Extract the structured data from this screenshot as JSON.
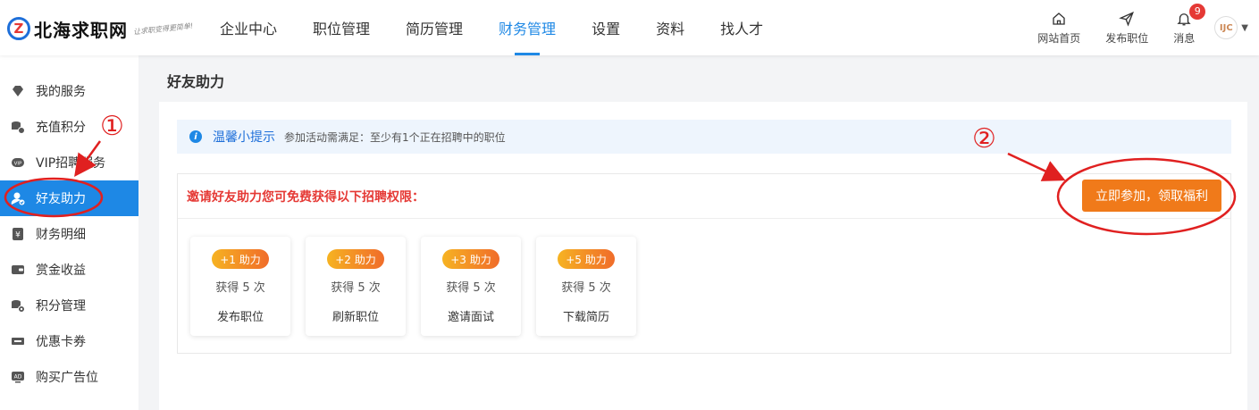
{
  "logo": {
    "mark": "Z",
    "name": "北海求职网",
    "slogan": "让求职变得更简单!"
  },
  "nav": [
    {
      "label": "企业中心",
      "active": false
    },
    {
      "label": "职位管理",
      "active": false
    },
    {
      "label": "简历管理",
      "active": false
    },
    {
      "label": "财务管理",
      "active": true
    },
    {
      "label": "设置",
      "active": false
    },
    {
      "label": "资料",
      "active": false
    },
    {
      "label": "找人才",
      "active": false
    }
  ],
  "header_right": {
    "home": "网站首页",
    "post": "发布职位",
    "messages": "消息",
    "message_count": "9",
    "avatar_text": "IJC"
  },
  "sidebar": [
    {
      "label": "我的服务",
      "icon": "diamond-icon"
    },
    {
      "label": "充值积分",
      "icon": "coins-add-icon"
    },
    {
      "label": "VIP招聘服务",
      "icon": "vip-icon"
    },
    {
      "label": "好友助力",
      "icon": "user-check-icon",
      "active": true
    },
    {
      "label": "财务明细",
      "icon": "yen-icon"
    },
    {
      "label": "赏金收益",
      "icon": "wallet-icon"
    },
    {
      "label": "积分管理",
      "icon": "coins-settings-icon"
    },
    {
      "label": "优惠卡券",
      "icon": "coupon-icon"
    },
    {
      "label": "购买广告位",
      "icon": "ad-icon"
    }
  ],
  "page": {
    "title": "好友助力",
    "tip_title": "温馨小提示",
    "tip_text": "参加活动需满足：至少有1个正在招聘中的职位",
    "invite_title": "邀请好友助力您可免费获得以下招聘权限：",
    "join_button": "立即参加，领取福利"
  },
  "cards": [
    {
      "pill": "+1 助力",
      "count": "获得 5 次",
      "label": "发布职位"
    },
    {
      "pill": "+2 助力",
      "count": "获得 5 次",
      "label": "刷新职位"
    },
    {
      "pill": "+3 助力",
      "count": "获得 5 次",
      "label": "邀请面试"
    },
    {
      "pill": "+5 助力",
      "count": "获得 5 次",
      "label": "下载简历"
    }
  ],
  "annotations": {
    "one": "①",
    "two": "②"
  },
  "colors": {
    "accent": "#1e88e5",
    "orange": "#f07a1a",
    "red": "#e53935"
  }
}
